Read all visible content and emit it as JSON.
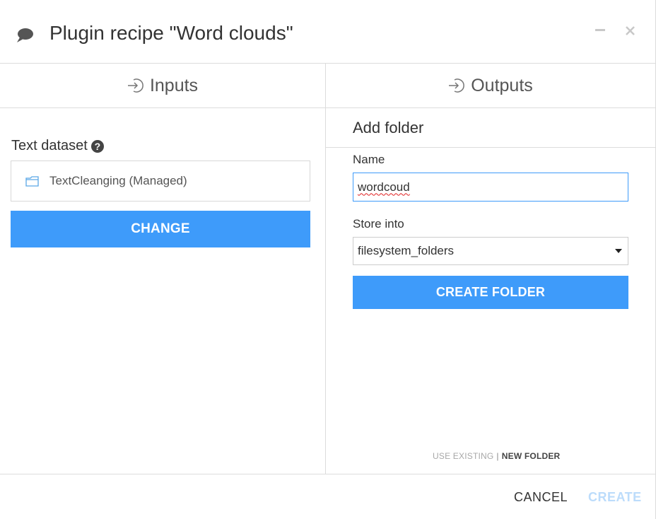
{
  "dialog": {
    "title": "Plugin recipe \"Word clouds\"",
    "icons": {
      "header": "chat-bubble-icon",
      "minimize": "minimize-icon",
      "close": "close-icon"
    }
  },
  "inputs": {
    "header": "Inputs",
    "icon": "input-arrow-icon",
    "field_label": "Text dataset",
    "help_icon_glyph": "?",
    "dataset_name": "TextCleanging (Managed)",
    "dataset_icon": "folder-icon",
    "change_label": "CHANGE"
  },
  "outputs": {
    "header": "Outputs",
    "icon": "input-arrow-icon",
    "section_title": "Add folder",
    "name_label": "Name",
    "name_value": "wordcoud",
    "store_label": "Store into",
    "store_value": "filesystem_folders",
    "create_folder_label": "CREATE FOLDER",
    "mode_existing": "USE EXISTING",
    "mode_separator": "|",
    "mode_new": "NEW FOLDER"
  },
  "footer": {
    "cancel_label": "CANCEL",
    "create_label": "CREATE"
  },
  "colors": {
    "primary": "#3e9bfa",
    "disabled": "#bcdcfb",
    "border": "#dcdcdc"
  }
}
